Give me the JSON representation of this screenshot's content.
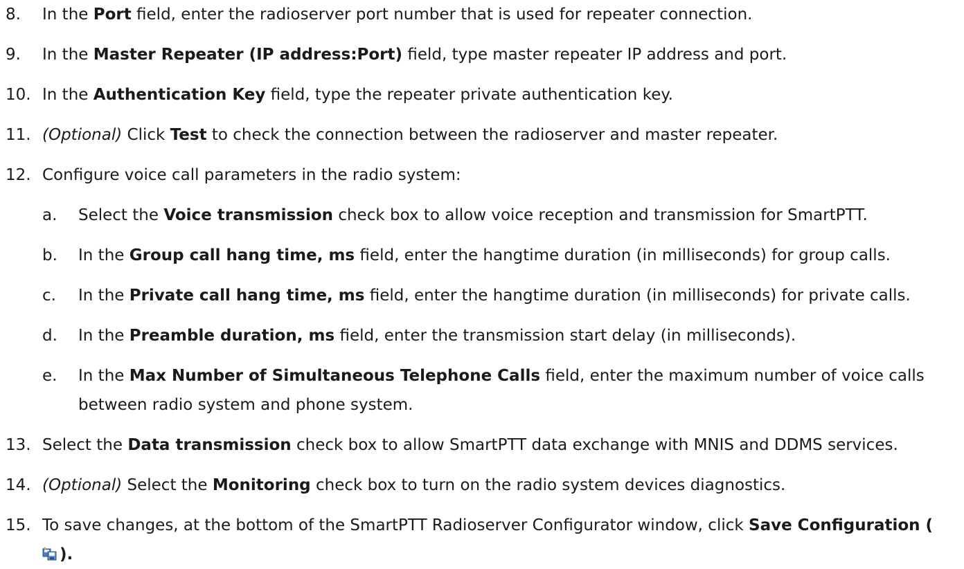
{
  "steps": [
    {
      "num": "8.",
      "pre": "In the ",
      "bold": "Port",
      "post": " field, enter the radioserver port number that is used for repeater connection."
    },
    {
      "num": "9.",
      "pre": "In the ",
      "bold": "Master Repeater (IP address:Port)",
      "post": " field, type master repeater IP address and port."
    },
    {
      "num": "10.",
      "pre": "In the ",
      "bold": "Authentication Key",
      "post": " field, type the repeater private authentication key."
    },
    {
      "num": "11.",
      "italic": "(Optional)",
      "pre": " Click ",
      "bold": "Test",
      "post": " to check the connection between the radioserver and master repeater."
    },
    {
      "num": "12.",
      "text": "Configure voice call parameters in the radio system:"
    },
    {
      "num": "13.",
      "pre": "Select the ",
      "bold": "Data transmission",
      "post": " check box to allow SmartPTT data exchange with MNIS and DDMS services."
    },
    {
      "num": "14.",
      "italic": "(Optional)",
      "pre": " Select the ",
      "bold": "Monitoring",
      "post": " check box to turn on the radio system devices diagnostics."
    },
    {
      "num": "15.",
      "pre": "To save changes, at the bottom of the SmartPTT Radioserver Configurator window, click ",
      "bold": "Save Configuration (",
      "post": ")."
    }
  ],
  "substeps": [
    {
      "num": "a.",
      "pre": "Select the ",
      "bold": "Voice transmission",
      "post": " check box to allow voice reception and transmission for SmartPTT."
    },
    {
      "num": "b.",
      "pre": "In the ",
      "bold": "Group call hang time, ms",
      "post": " field, enter the hangtime duration (in milliseconds) for group calls."
    },
    {
      "num": "c.",
      "pre": "In the ",
      "bold": "Private call hang time, ms",
      "post": " field, enter the hangtime duration (in milliseconds) for private calls."
    },
    {
      "num": "d.",
      "pre": "In the ",
      "bold": "Preamble duration, ms",
      "post": " field, enter the transmission start delay (in milliseconds)."
    },
    {
      "num": "e.",
      "pre": "In the ",
      "bold": "Max Number of Simultaneous Telephone Calls",
      "post": " field, enter the maximum number of voice calls between radio system and phone system."
    }
  ],
  "icons": {
    "save_configuration": "save-configuration-icon"
  }
}
